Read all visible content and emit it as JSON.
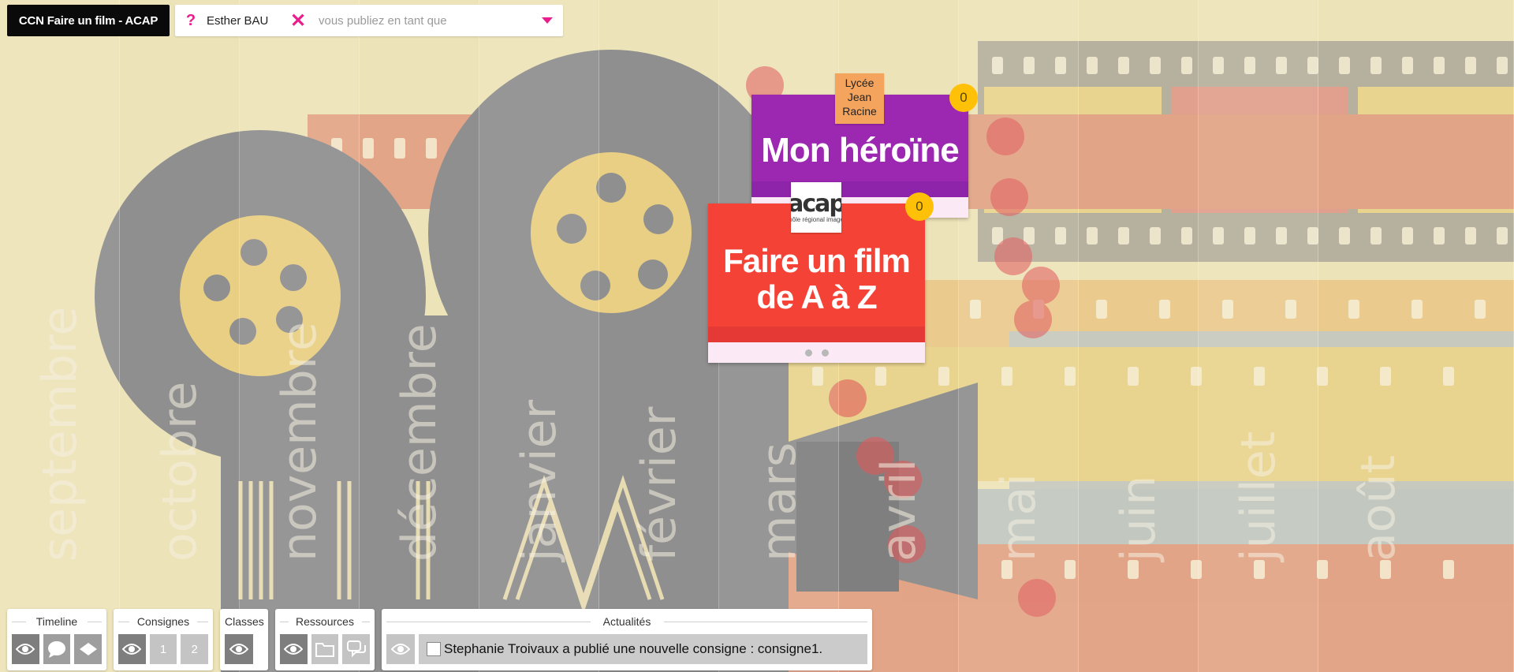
{
  "header": {
    "course_title": "CCN Faire un film - ACAP",
    "help_icon": "?",
    "user_name": "Esther BAU",
    "logout_icon": "✕",
    "publish_as_placeholder": "vous publiez en tant que"
  },
  "months": [
    "septembre",
    "octobre",
    "novembre",
    "décembre",
    "janvier",
    "février",
    "mars",
    "avril",
    "mai",
    "juin",
    "juillet",
    "août"
  ],
  "cards": {
    "heroine": {
      "title": "Mon héroïne",
      "author_tag": [
        "Lycée",
        "Jean",
        "Racine"
      ],
      "count": "0",
      "color": "#9c27b0"
    },
    "film": {
      "title_line1": "Faire un film",
      "title_line2": "de A à Z",
      "logo_text": "acap",
      "logo_subtext": "pôle régional image",
      "count": "0",
      "color": "#f44336"
    }
  },
  "toolbar": {
    "timeline": {
      "title": "Timeline",
      "icons": [
        "eye-icon",
        "comment-icon",
        "layers-icon"
      ]
    },
    "consignes": {
      "title": "Consignes",
      "icons": [
        "eye-icon"
      ],
      "pages": [
        "1",
        "2"
      ]
    },
    "classes": {
      "title": "Classes",
      "icons": [
        "eye-icon"
      ]
    },
    "ressources": {
      "title": "Ressources",
      "icons": [
        "eye-icon",
        "folder-icon",
        "chat-icon"
      ]
    },
    "actualites": {
      "title": "Actualités",
      "news": "Stephanie Troivaux a publié une nouvelle consigne : consigne1."
    }
  }
}
